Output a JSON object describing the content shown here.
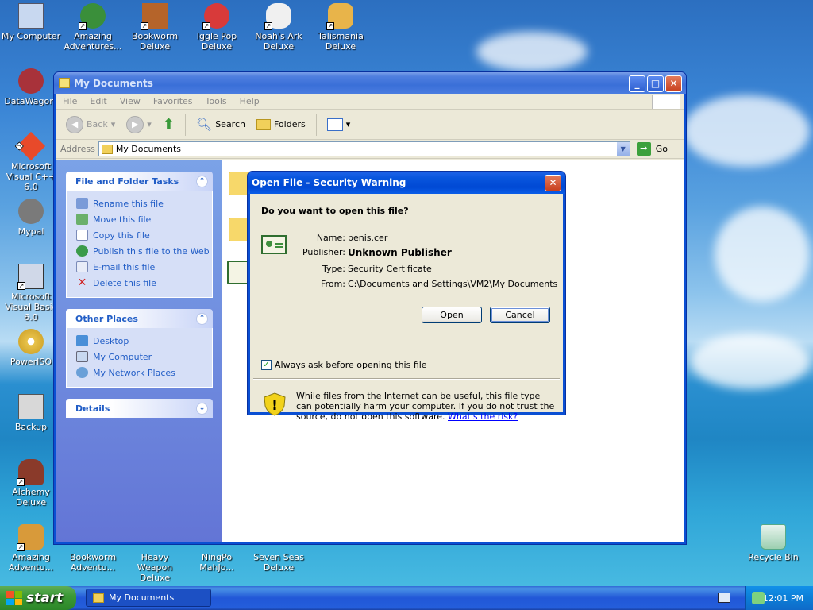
{
  "desktop": {
    "icons": [
      {
        "label": "My Computer"
      },
      {
        "label": "Amazing Adventures..."
      },
      {
        "label": "Bookworm Deluxe"
      },
      {
        "label": "Iggle Pop Deluxe"
      },
      {
        "label": "Noah's Ark Deluxe"
      },
      {
        "label": "Talismania Deluxe"
      },
      {
        "label": "DataWagon."
      },
      {
        "label": "Microsoft Visual C++ 6.0"
      },
      {
        "label": "Mypal"
      },
      {
        "label": "Microsoft Visual Basic 6.0"
      },
      {
        "label": "PowerISO"
      },
      {
        "label": "Backup"
      },
      {
        "label": "Alchemy Deluxe"
      },
      {
        "label": "Amazing Adventu..."
      },
      {
        "label": "Bookworm Adventu..."
      },
      {
        "label": "Heavy Weapon Deluxe"
      },
      {
        "label": "NingPo MahJo..."
      },
      {
        "label": "Seven Seas Deluxe"
      },
      {
        "label": "Recycle Bin"
      }
    ]
  },
  "explorer": {
    "title": "My Documents",
    "menu": [
      "File",
      "Edit",
      "View",
      "Favorites",
      "Tools",
      "Help"
    ],
    "toolbar": {
      "back": "Back",
      "search": "Search",
      "folders": "Folders"
    },
    "address_label": "Address",
    "address_value": "My Documents",
    "go_label": "Go",
    "file_folder_tasks": {
      "title": "File and Folder Tasks",
      "items": [
        "Rename this file",
        "Move this file",
        "Copy this file",
        "Publish this file to the Web",
        "E-mail this file",
        "Delete this file"
      ]
    },
    "other_places": {
      "title": "Other Places",
      "items": [
        "Desktop",
        "My Computer",
        "My Network Places"
      ]
    },
    "details": {
      "title": "Details"
    }
  },
  "dialog": {
    "title": "Open File - Security Warning",
    "question": "Do you want to open this file?",
    "fields": [
      {
        "key": "Name:",
        "value": "penis.cer"
      },
      {
        "key": "Publisher:",
        "value": "Unknown Publisher"
      },
      {
        "key": "Type:",
        "value": "Security Certificate"
      },
      {
        "key": "From:",
        "value": "C:\\Documents and Settings\\VM2\\My Documents"
      }
    ],
    "open_label": "Open",
    "cancel_label": "Cancel",
    "checkbox_label": "Always ask before opening this file",
    "checkbox_checked": true,
    "warning_text": "While files from the Internet can be useful, this file type can potentially harm your computer. If you do not trust the source, do not open this software.",
    "risk_link": "What's the risk?"
  },
  "taskbar": {
    "start_label": "start",
    "task_label": "My Documents",
    "clock": "12:01 PM"
  },
  "colors": {
    "title_active": "#0054e3",
    "task_blue": "#215dc6",
    "start_green": "#3c9a37"
  }
}
